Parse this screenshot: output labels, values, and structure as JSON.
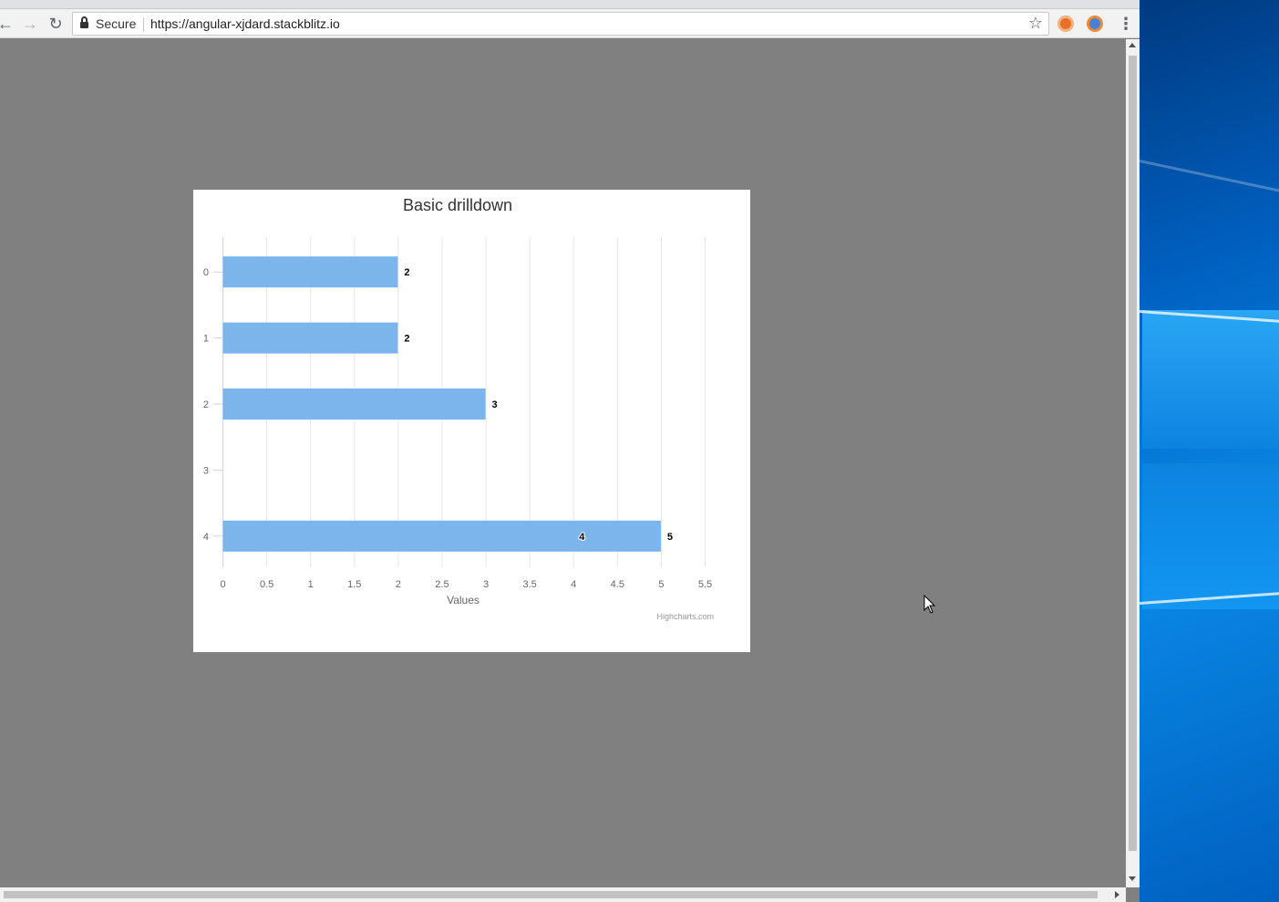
{
  "browser": {
    "secure_label": "Secure",
    "url": "https://angular-xjdard.stackblitz.io"
  },
  "chart": {
    "title": "Basic drilldown",
    "credits": "Highcharts.com"
  },
  "chart_data": {
    "type": "bar",
    "orientation": "horizontal",
    "title": "Basic drilldown",
    "xlabel": "",
    "ylabel": "Values",
    "categories": [
      "0",
      "1",
      "2",
      "3",
      "4"
    ],
    "values": [
      2,
      2,
      3,
      null,
      5
    ],
    "data_labels": [
      "2",
      "2",
      "3",
      "",
      "5"
    ],
    "inner_annotation": {
      "category": "4",
      "text": "4",
      "at_value": 4.1
    },
    "value_axis_ticks": [
      "0",
      "0.5",
      "1",
      "1.5",
      "2",
      "2.5",
      "3",
      "3.5",
      "4",
      "4.5",
      "5",
      "5.5"
    ],
    "xlim": [
      0,
      5.5
    ],
    "grid": true,
    "legend": "none",
    "bar_color": "#7cb5ec"
  }
}
